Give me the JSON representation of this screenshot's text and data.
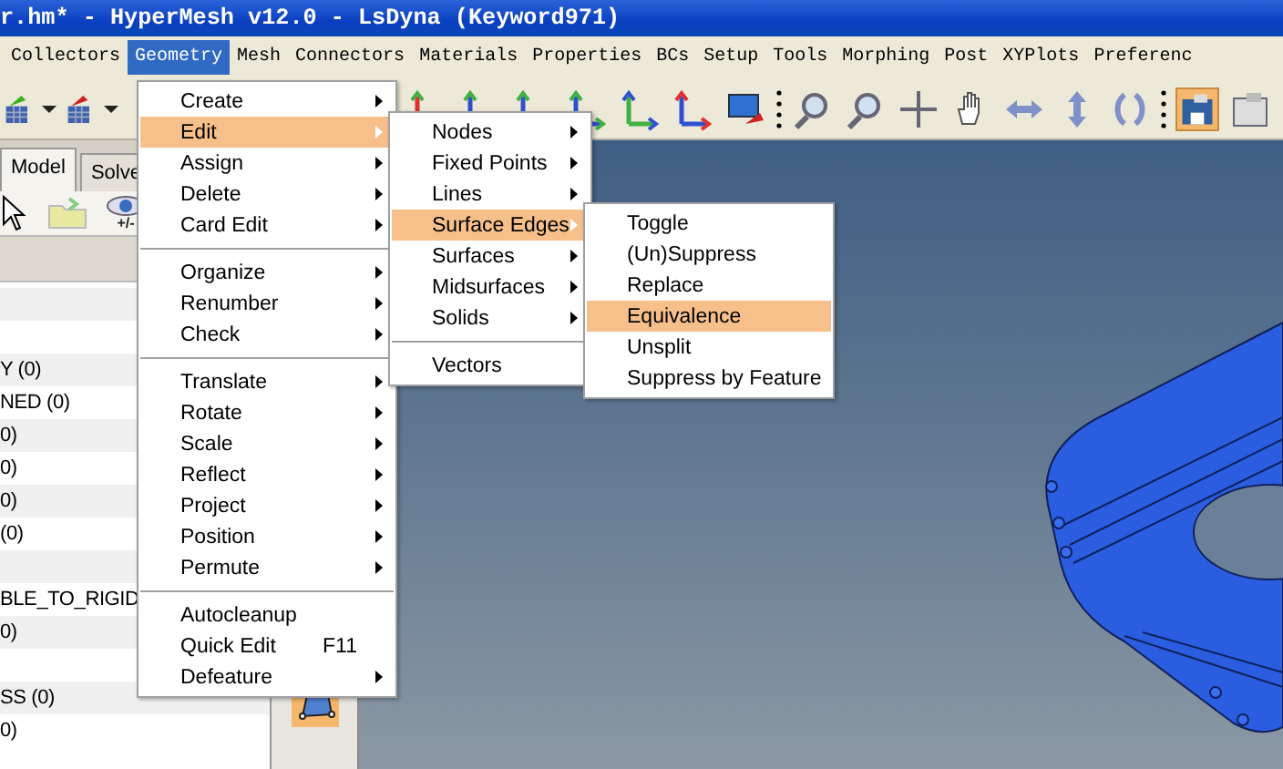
{
  "window": {
    "title": "r.hm* - HyperMesh v12.0 - LsDyna (Keyword971)"
  },
  "menubar": [
    {
      "label": "Collectors",
      "selected": false
    },
    {
      "label": "Geometry",
      "selected": true
    },
    {
      "label": "Mesh",
      "selected": false
    },
    {
      "label": "Connectors",
      "selected": false
    },
    {
      "label": "Materials",
      "selected": false
    },
    {
      "label": "Properties",
      "selected": false
    },
    {
      "label": "BCs",
      "selected": false
    },
    {
      "label": "Setup",
      "selected": false
    },
    {
      "label": "Tools",
      "selected": false
    },
    {
      "label": "Morphing",
      "selected": false
    },
    {
      "label": "Post",
      "selected": false
    },
    {
      "label": "XYPlots",
      "selected": false
    },
    {
      "label": "Preferenc",
      "selected": false
    }
  ],
  "browser": {
    "tabs": [
      {
        "label": "Model",
        "selected": true
      },
      {
        "label": "Solve",
        "selected": false
      }
    ],
    "toggle_label": "+/-",
    "rows": [
      {
        "kind": "blank"
      },
      {
        "kind": "blank"
      },
      {
        "kind": "text",
        "label": "Y (0)"
      },
      {
        "kind": "text",
        "label": "NED (0)"
      },
      {
        "kind": "text",
        "label": "0)"
      },
      {
        "kind": "text",
        "label": "0)"
      },
      {
        "kind": "text",
        "label": "0)"
      },
      {
        "kind": "text",
        "label": "(0)"
      },
      {
        "kind": "blank"
      },
      {
        "kind": "text",
        "label": "BLE_TO_RIGID"
      },
      {
        "kind": "text",
        "label": "0)"
      },
      {
        "kind": "blank"
      },
      {
        "kind": "text",
        "label": "SS (0)"
      },
      {
        "kind": "text",
        "label": "0)"
      }
    ]
  },
  "menus": [
    {
      "items": [
        {
          "kind": "item",
          "label": "Create",
          "submenu": true,
          "selected": false
        },
        {
          "kind": "item",
          "label": "Edit",
          "submenu": true,
          "selected": true
        },
        {
          "kind": "item",
          "label": "Assign",
          "submenu": true,
          "selected": false
        },
        {
          "kind": "item",
          "label": "Delete",
          "submenu": true,
          "selected": false
        },
        {
          "kind": "item",
          "label": "Card Edit",
          "submenu": true,
          "selected": false
        },
        {
          "kind": "separator"
        },
        {
          "kind": "item",
          "label": "Organize",
          "submenu": true,
          "selected": false
        },
        {
          "kind": "item",
          "label": "Renumber",
          "submenu": true,
          "selected": false
        },
        {
          "kind": "item",
          "label": "Check",
          "submenu": true,
          "selected": false
        },
        {
          "kind": "separator"
        },
        {
          "kind": "item",
          "label": "Translate",
          "submenu": true,
          "selected": false
        },
        {
          "kind": "item",
          "label": "Rotate",
          "submenu": true,
          "selected": false
        },
        {
          "kind": "item",
          "label": "Scale",
          "submenu": true,
          "selected": false
        },
        {
          "kind": "item",
          "label": "Reflect",
          "submenu": true,
          "selected": false
        },
        {
          "kind": "item",
          "label": "Project",
          "submenu": true,
          "selected": false
        },
        {
          "kind": "item",
          "label": "Position",
          "submenu": true,
          "selected": false
        },
        {
          "kind": "item",
          "label": "Permute",
          "submenu": true,
          "selected": false
        },
        {
          "kind": "separator"
        },
        {
          "kind": "item",
          "label": "Autocleanup",
          "submenu": false,
          "selected": false
        },
        {
          "kind": "item",
          "label": "Quick Edit",
          "shortcut": "F11",
          "submenu": false,
          "selected": false
        },
        {
          "kind": "item",
          "label": "Defeature",
          "submenu": true,
          "selected": false
        }
      ]
    },
    {
      "items": [
        {
          "kind": "item",
          "label": "Nodes",
          "submenu": true,
          "selected": false
        },
        {
          "kind": "item",
          "label": "Fixed Points",
          "submenu": true,
          "selected": false
        },
        {
          "kind": "item",
          "label": "Lines",
          "submenu": true,
          "selected": false
        },
        {
          "kind": "item",
          "label": "Surface Edges",
          "submenu": true,
          "selected": true
        },
        {
          "kind": "item",
          "label": "Surfaces",
          "submenu": true,
          "selected": false
        },
        {
          "kind": "item",
          "label": "Midsurfaces",
          "submenu": true,
          "selected": false
        },
        {
          "kind": "item",
          "label": "Solids",
          "submenu": true,
          "selected": false
        },
        {
          "kind": "separator"
        },
        {
          "kind": "item",
          "label": "Vectors",
          "submenu": false,
          "selected": false
        }
      ]
    },
    {
      "items": [
        {
          "kind": "item",
          "label": "Toggle",
          "submenu": false,
          "selected": false
        },
        {
          "kind": "item",
          "label": "(Un)Suppress",
          "submenu": false,
          "selected": false
        },
        {
          "kind": "item",
          "label": "Replace",
          "submenu": false,
          "selected": false
        },
        {
          "kind": "item",
          "label": "Equivalence",
          "submenu": false,
          "selected": true
        },
        {
          "kind": "item",
          "label": "Unsplit",
          "submenu": false,
          "selected": false
        },
        {
          "kind": "item",
          "label": "Suppress by Feature",
          "submenu": false,
          "selected": false
        }
      ]
    }
  ]
}
